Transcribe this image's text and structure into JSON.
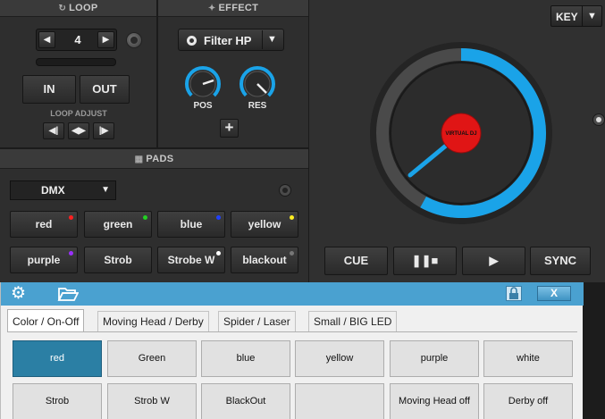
{
  "loop": {
    "header": "LOOP",
    "header_icon": "loop-icon",
    "value": "4",
    "in_label": "IN",
    "out_label": "OUT",
    "adjust_label": "LOOP ADJUST",
    "adjust_buttons": [
      "shift-left-icon",
      "expand-icon",
      "shift-right-icon"
    ]
  },
  "effect": {
    "header": "EFFECT",
    "header_icon": "effect-icon",
    "selected": "Filter HP",
    "knobs": [
      {
        "label": "POS",
        "level": 0.45
      },
      {
        "label": "RES",
        "level": 0.75
      }
    ],
    "add_label": "+"
  },
  "pads": {
    "header": "PADS",
    "header_icon": "grid-icon",
    "mode": "DMX",
    "buttons": [
      {
        "label": "red",
        "dot": "#ff2020"
      },
      {
        "label": "green",
        "dot": "#22d022"
      },
      {
        "label": "blue",
        "dot": "#2040ff"
      },
      {
        "label": "yellow",
        "dot": "#ffee22"
      },
      {
        "label": "purple",
        "dot": "#9b30ff"
      },
      {
        "label": "Strob",
        "dot": ""
      },
      {
        "label": "Strobe W",
        "dot": "#ffffff"
      },
      {
        "label": "blackout",
        "dot": "#777777"
      }
    ]
  },
  "deck": {
    "key_label": "KEY",
    "key_arrow": "▼",
    "jog_logo": "VIRTUAL DJ",
    "jog_progress": 0.58,
    "accent": "#1aa3e8",
    "transport": [
      {
        "name": "cue-button",
        "label": "CUE"
      },
      {
        "name": "play-pause-button",
        "label": "❚❚■"
      },
      {
        "name": "play-button",
        "label": "▶"
      },
      {
        "name": "sync-button",
        "label": "SYNC"
      }
    ]
  },
  "dmx_window": {
    "titlebar_color": "#4aa1d0",
    "close_label": "X",
    "tabs": [
      "Color / On-Off",
      "Moving Head / Derby",
      "Spider / Laser",
      "Small / BIG LED"
    ],
    "active_tab": 0,
    "buttons": [
      [
        "red",
        "Green",
        "blue",
        "yellow",
        "purple",
        "white"
      ],
      [
        "Strob",
        "Strob W",
        "BlackOut",
        "",
        "Moving Head off",
        "Derby off"
      ]
    ],
    "selected_button": "red"
  }
}
